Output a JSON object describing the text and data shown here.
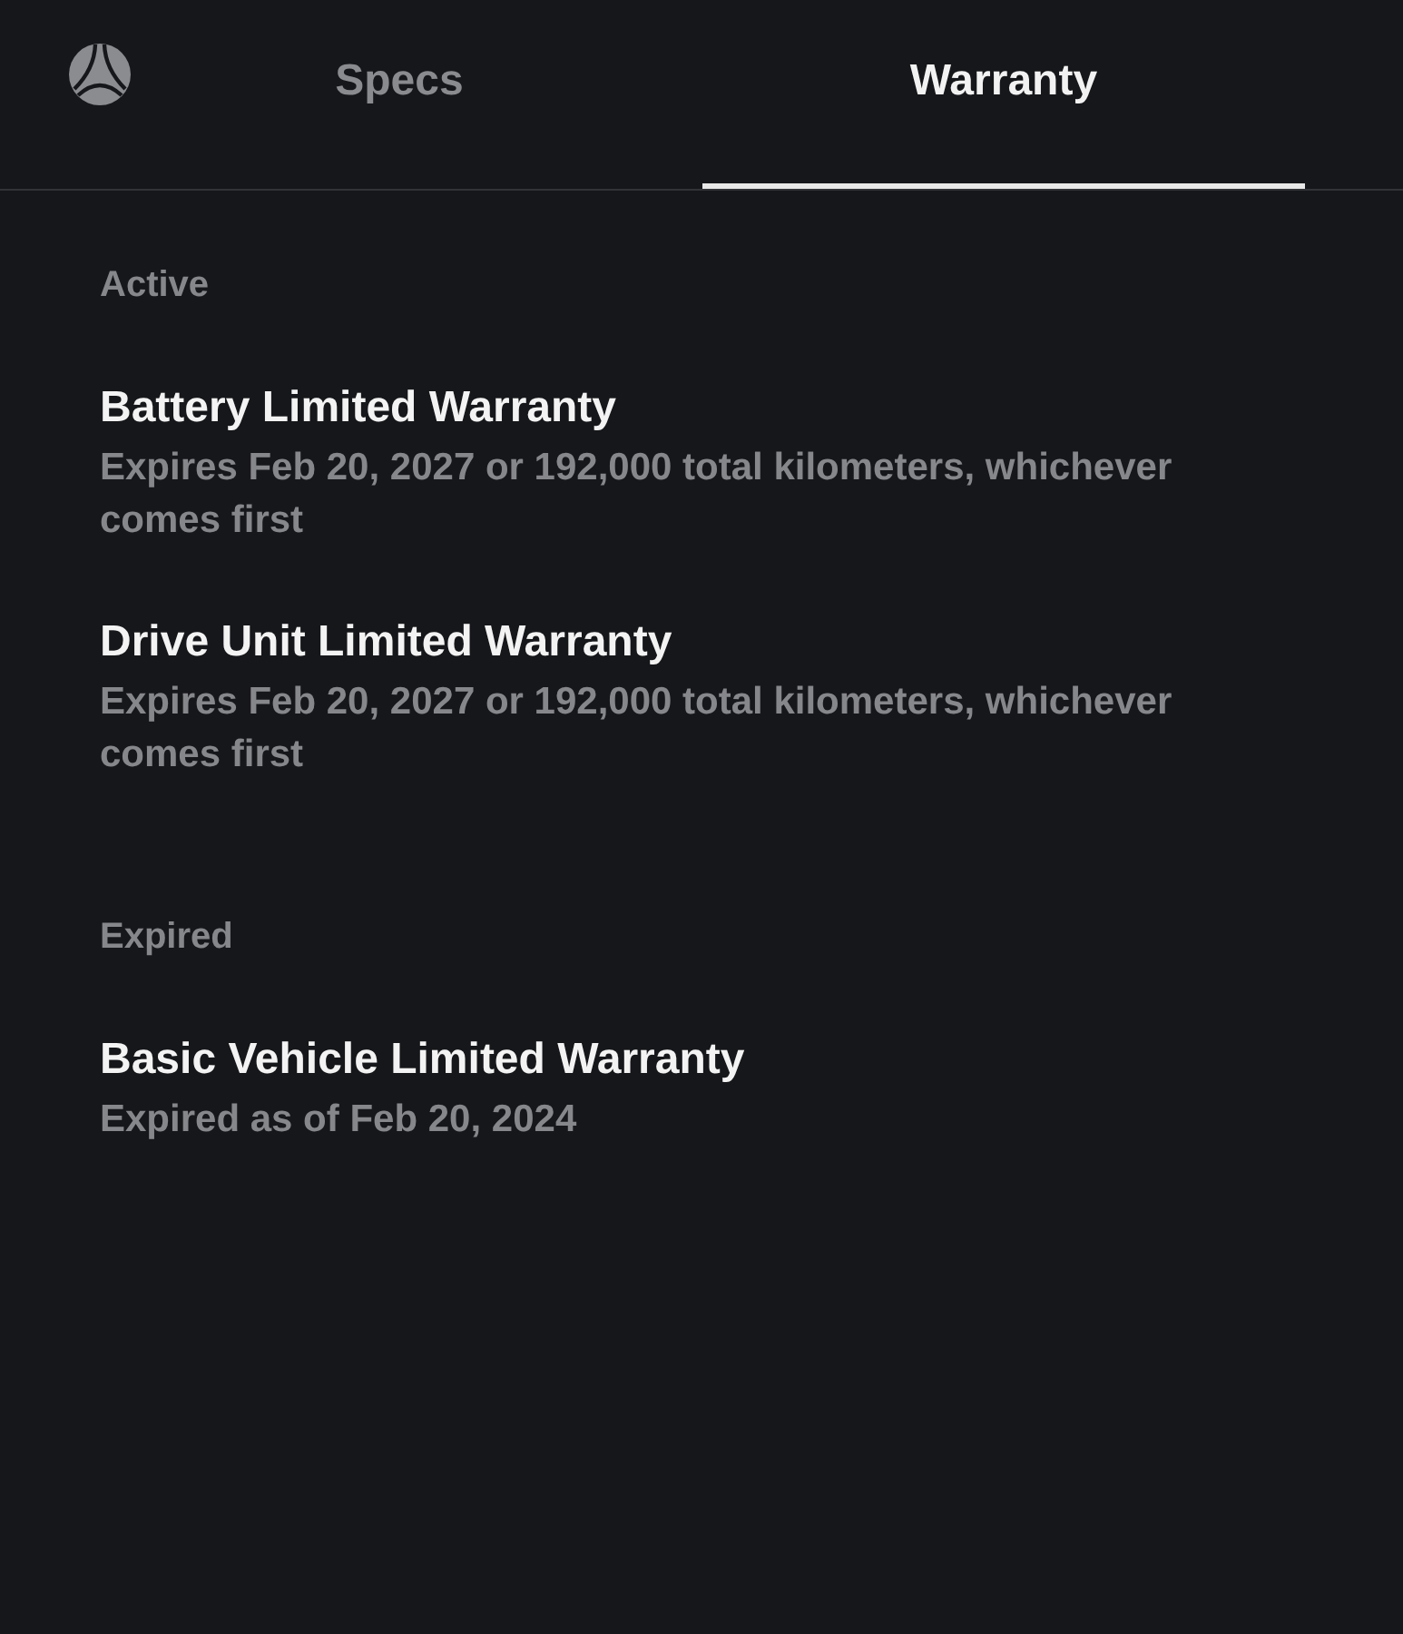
{
  "header": {
    "tabs": [
      {
        "label": "Specs",
        "selected": false
      },
      {
        "label": "Warranty",
        "selected": true
      }
    ]
  },
  "sections": [
    {
      "heading": "Active",
      "items": [
        {
          "title": "Battery Limited Warranty",
          "description": "Expires Feb 20, 2027 or 192,000 total kilometers, whichever comes first"
        },
        {
          "title": "Drive Unit Limited Warranty",
          "description": "Expires Feb 20, 2027 or 192,000 total kilometers, whichever comes first"
        }
      ]
    },
    {
      "heading": "Expired",
      "items": [
        {
          "title": "Basic Vehicle Limited Warranty",
          "description": "Expired as of Feb 20, 2024"
        }
      ]
    }
  ]
}
